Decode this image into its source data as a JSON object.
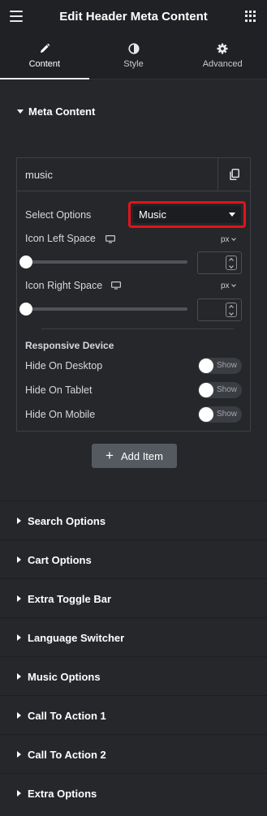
{
  "header": {
    "title": "Edit Header Meta Content",
    "menu_icon": "hamburger-menu-icon",
    "apps_icon": "apps-grid-icon"
  },
  "tabs": [
    {
      "label": "Content",
      "icon": "pencil-icon",
      "active": true
    },
    {
      "label": "Style",
      "icon": "half-circle-contrast-icon",
      "active": false
    },
    {
      "label": "Advanced",
      "icon": "gear-icon",
      "active": false
    }
  ],
  "meta_section": {
    "title": "Meta Content",
    "item": {
      "title": "music",
      "select_label": "Select Options",
      "select_value": "Music",
      "icon_left_label": "Icon Left Space",
      "icon_left_unit": "px",
      "icon_left_value": "",
      "icon_right_label": "Icon Right Space",
      "icon_right_unit": "px",
      "icon_right_value": "",
      "responsive_heading": "Responsive Device",
      "hide_desktop_label": "Hide On Desktop",
      "hide_tablet_label": "Hide On Tablet",
      "hide_mobile_label": "Hide On Mobile",
      "toggle_text": "Show"
    },
    "add_item_label": "Add Item"
  },
  "collapsed_sections": [
    "Search Options",
    "Cart Options",
    "Extra Toggle Bar",
    "Language Switcher",
    "Music Options",
    "Call To Action 1",
    "Call To Action 2",
    "Extra Options"
  ],
  "colors": {
    "panel_bg": "#26272b",
    "header_bg": "#1f2124",
    "highlight": "#e4121a",
    "button_bg": "#555a60"
  }
}
